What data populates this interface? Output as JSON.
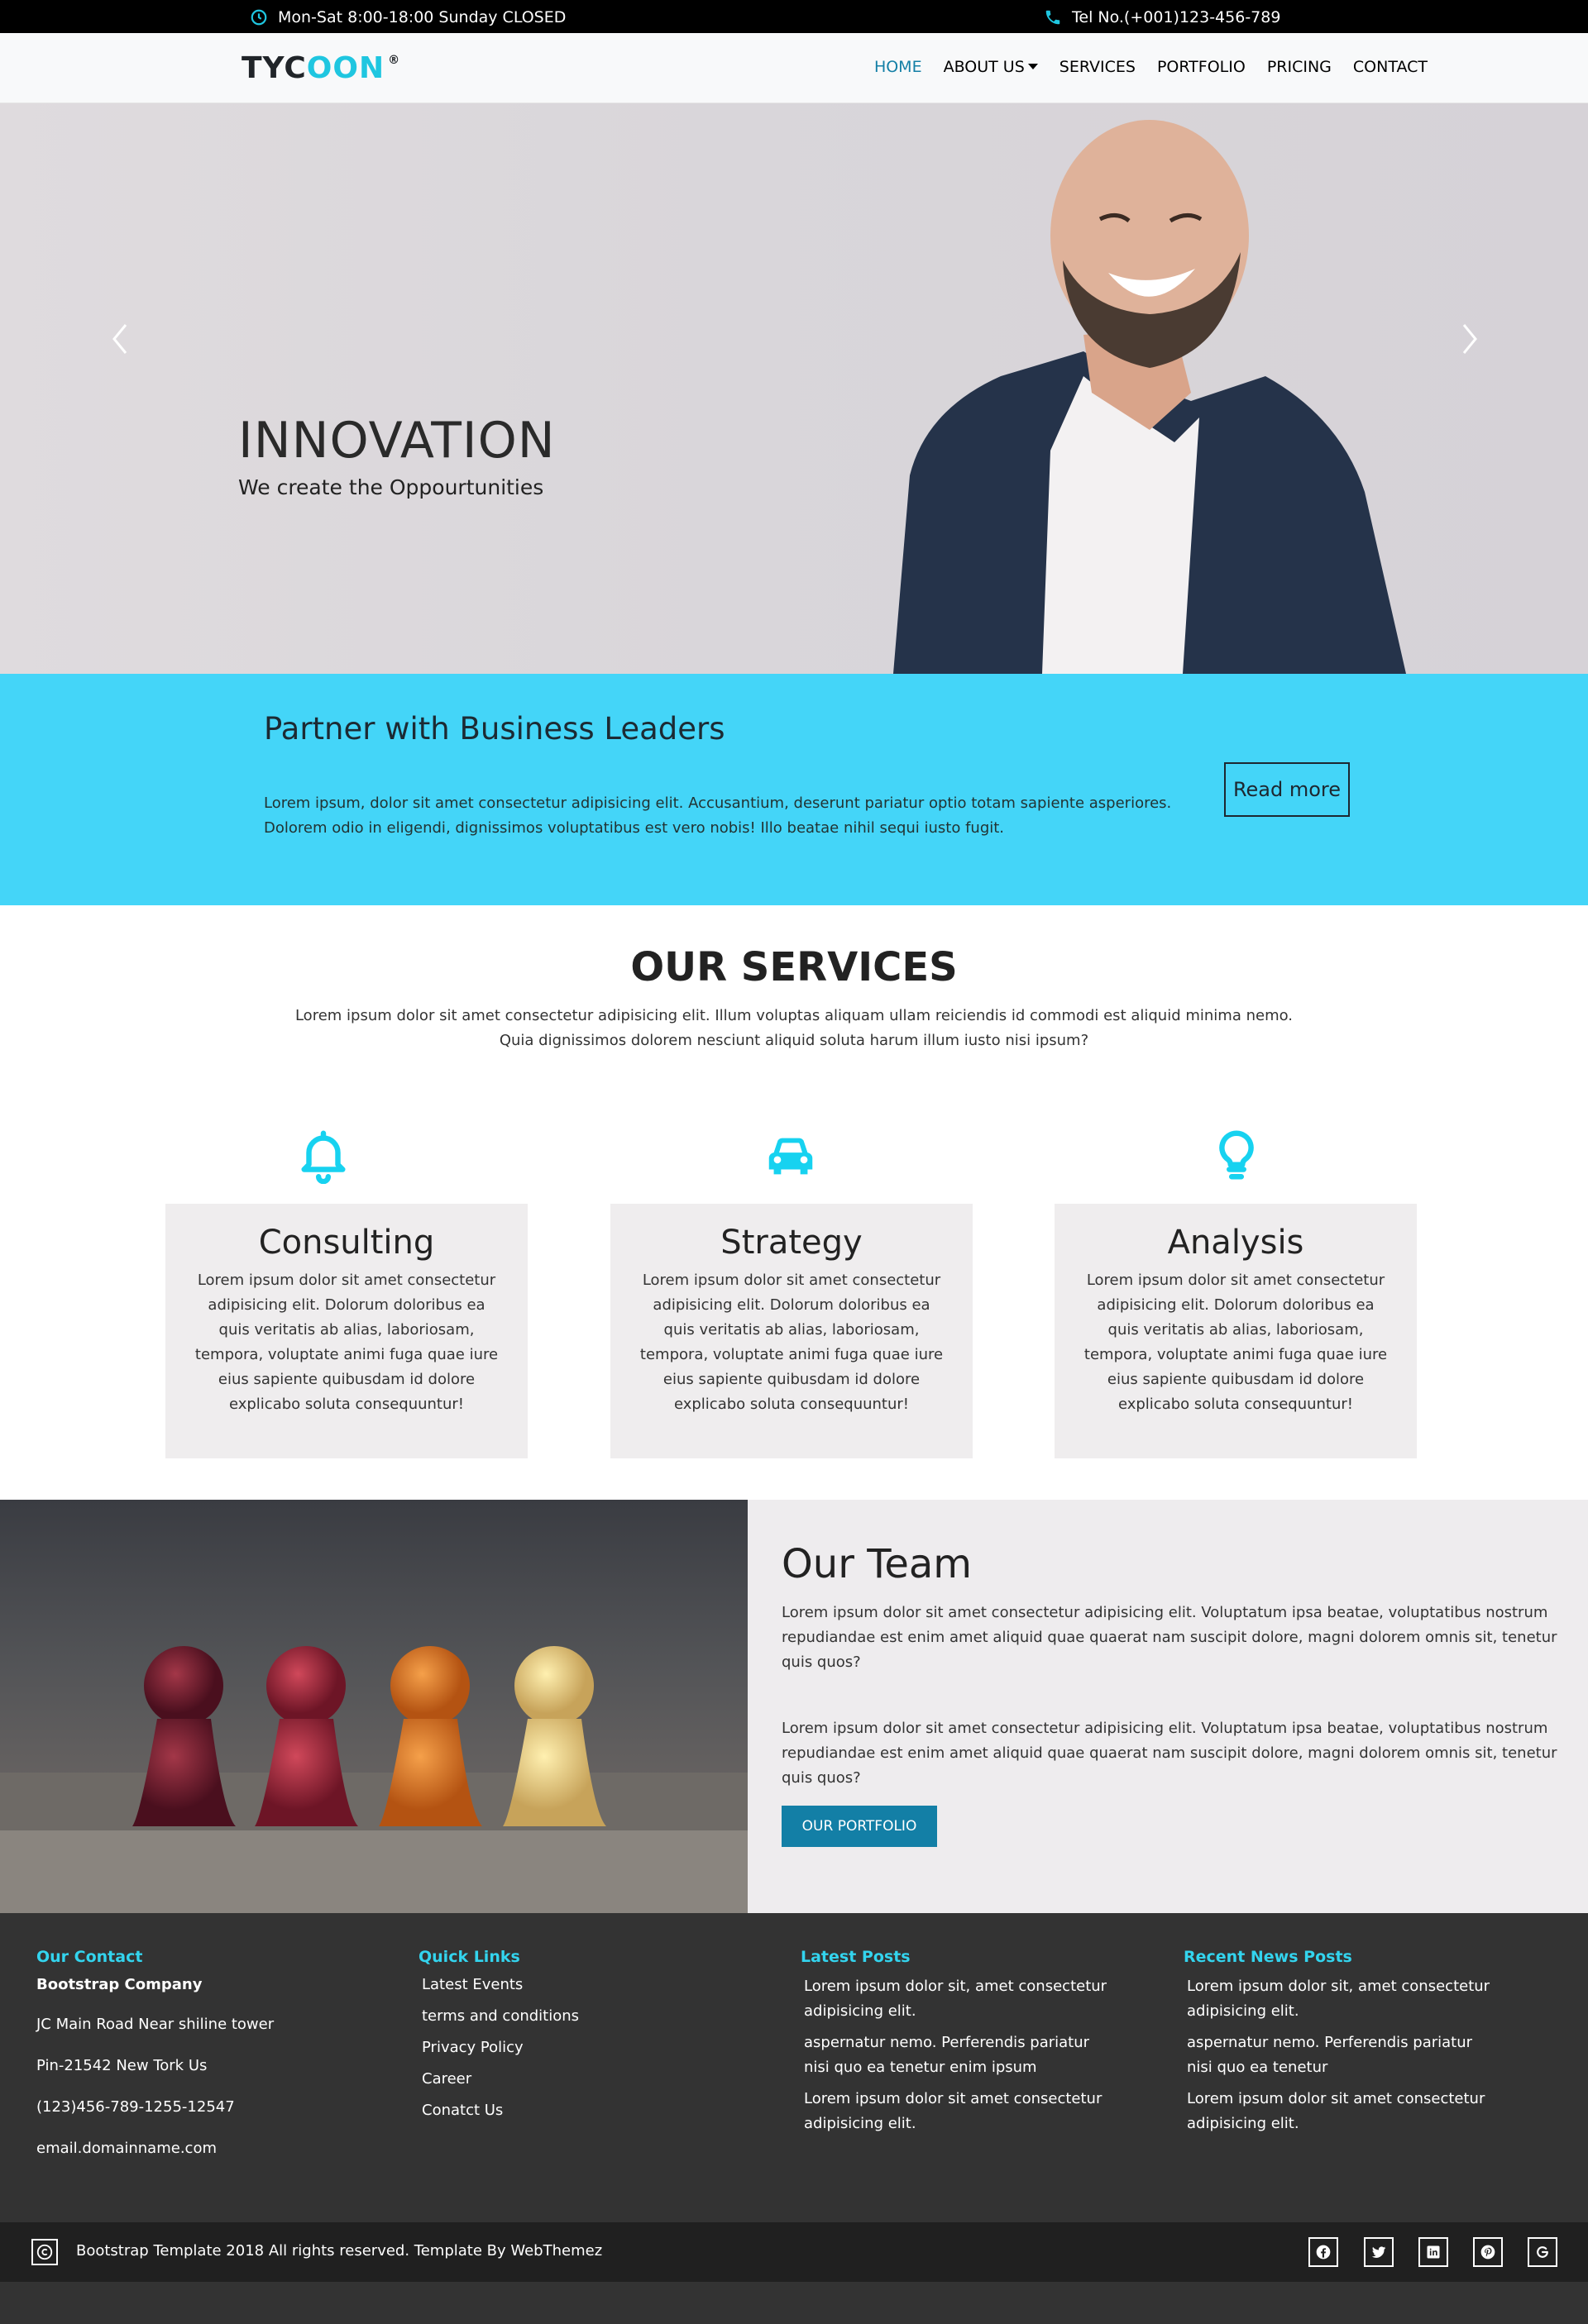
{
  "topbar": {
    "hours": "Mon-Sat 8:00-18:00 Sunday CLOSED",
    "phone": "Tel No.(+001)123-456-789"
  },
  "brand": {
    "logo_dark": "TYC",
    "logo_accent": "OON",
    "logo_mark": "®"
  },
  "nav": {
    "items": [
      "HOME",
      "ABOUT US",
      "SERVICES",
      "PORTFOLIO",
      "PRICING",
      "CONTACT"
    ],
    "active": "HOME"
  },
  "hero": {
    "title": "INNOVATION",
    "subtitle": "We create the Oppourtunities"
  },
  "partner": {
    "title": "Partner with Business Leaders",
    "text": "Lorem ipsum, dolor sit amet consectetur adipisicing elit. Accusantium, deserunt pariatur optio totam sapiente asperiores. Dolorem odio in eligendi, dignissimos voluptatibus est vero nobis! Illo beatae nihil sequi iusto fugit.",
    "button": "Read more"
  },
  "services": {
    "title": "OUR SERVICES",
    "description": "Lorem ipsum dolor sit amet consectetur adipisicing elit. Illum voluptas aliquam ullam reiciendis id commodi est aliquid minima nemo. Quia dignissimos dolorem nesciunt aliquid soluta harum illum iusto nisi ipsum?",
    "cards": [
      {
        "icon": "bell-icon",
        "title": "Consulting",
        "text": "Lorem ipsum dolor sit amet consectetur adipisicing elit. Dolorum doloribus ea quis veritatis ab alias, laboriosam, tempora, voluptate animi fuga quae iure eius sapiente quibusdam id dolore explicabo soluta consequuntur!"
      },
      {
        "icon": "car-icon",
        "title": "Strategy",
        "text": "Lorem ipsum dolor sit amet consectetur adipisicing elit. Dolorum doloribus ea quis veritatis ab alias, laboriosam, tempora, voluptate animi fuga quae iure eius sapiente quibusdam id dolore explicabo soluta consequuntur!"
      },
      {
        "icon": "lightbulb-icon",
        "title": "Analysis",
        "text": "Lorem ipsum dolor sit amet consectetur adipisicing elit. Dolorum doloribus ea quis veritatis ab alias, laboriosam, tempora, voluptate animi fuga quae iure eius sapiente quibusdam id dolore explicabo soluta consequuntur!"
      }
    ]
  },
  "team": {
    "title": "Our Team",
    "p1": "Lorem ipsum dolor sit amet consectetur adipisicing elit. Voluptatum ipsa beatae, voluptatibus nostrum repudiandae est enim amet aliquid quae quaerat nam suscipit dolore, magni dolorem omnis sit, tenetur quis quos?",
    "p2": "Lorem ipsum dolor sit amet consectetur adipisicing elit. Voluptatum ipsa beatae, voluptatibus nostrum repudiandae est enim amet aliquid quae quaerat nam suscipit dolore, magni dolorem omnis sit, tenetur quis quos?",
    "button": "OUR PORTFOLIO"
  },
  "footer": {
    "contact": {
      "title": "Our Contact",
      "company": "Bootstrap Company",
      "address": "JC Main Road Near shiline tower",
      "pin": "Pin-21542 New Tork Us",
      "phone": "(123)456-789-1255-12547",
      "email": "email.domainname.com"
    },
    "quick_links": {
      "title": "Quick Links",
      "items": [
        "Latest Events",
        "terms and conditions",
        "Privacy Policy",
        "Career",
        "Conatct Us"
      ]
    },
    "latest_posts": {
      "title": "Latest Posts",
      "items": [
        "Lorem ipsum dolor sit, amet consectetur adipisicing elit.",
        "aspernatur nemo. Perferendis pariatur nisi quo ea tenetur enim ipsum",
        "Lorem ipsum dolor sit amet consectetur adipisicing elit."
      ]
    },
    "recent_news": {
      "title": "Recent News Posts",
      "items": [
        "Lorem ipsum dolor sit, amet consectetur adipisicing elit.",
        "aspernatur nemo. Perferendis pariatur nisi quo ea tenetur",
        "Lorem ipsum dolor sit amet consectetur adipisicing elit."
      ]
    },
    "copyright": "Bootstrap Template 2018 All rights reserved. Template By WebThemez",
    "social": [
      "facebook-icon",
      "twitter-icon",
      "linkedin-icon",
      "pinterest-icon",
      "google-icon"
    ]
  },
  "colors": {
    "accent": "#1fc6e0",
    "partner_band": "#44d5f8",
    "primary_button": "#137fa6",
    "footer_bg": "#333333",
    "footer_heading": "#33d4ee"
  }
}
